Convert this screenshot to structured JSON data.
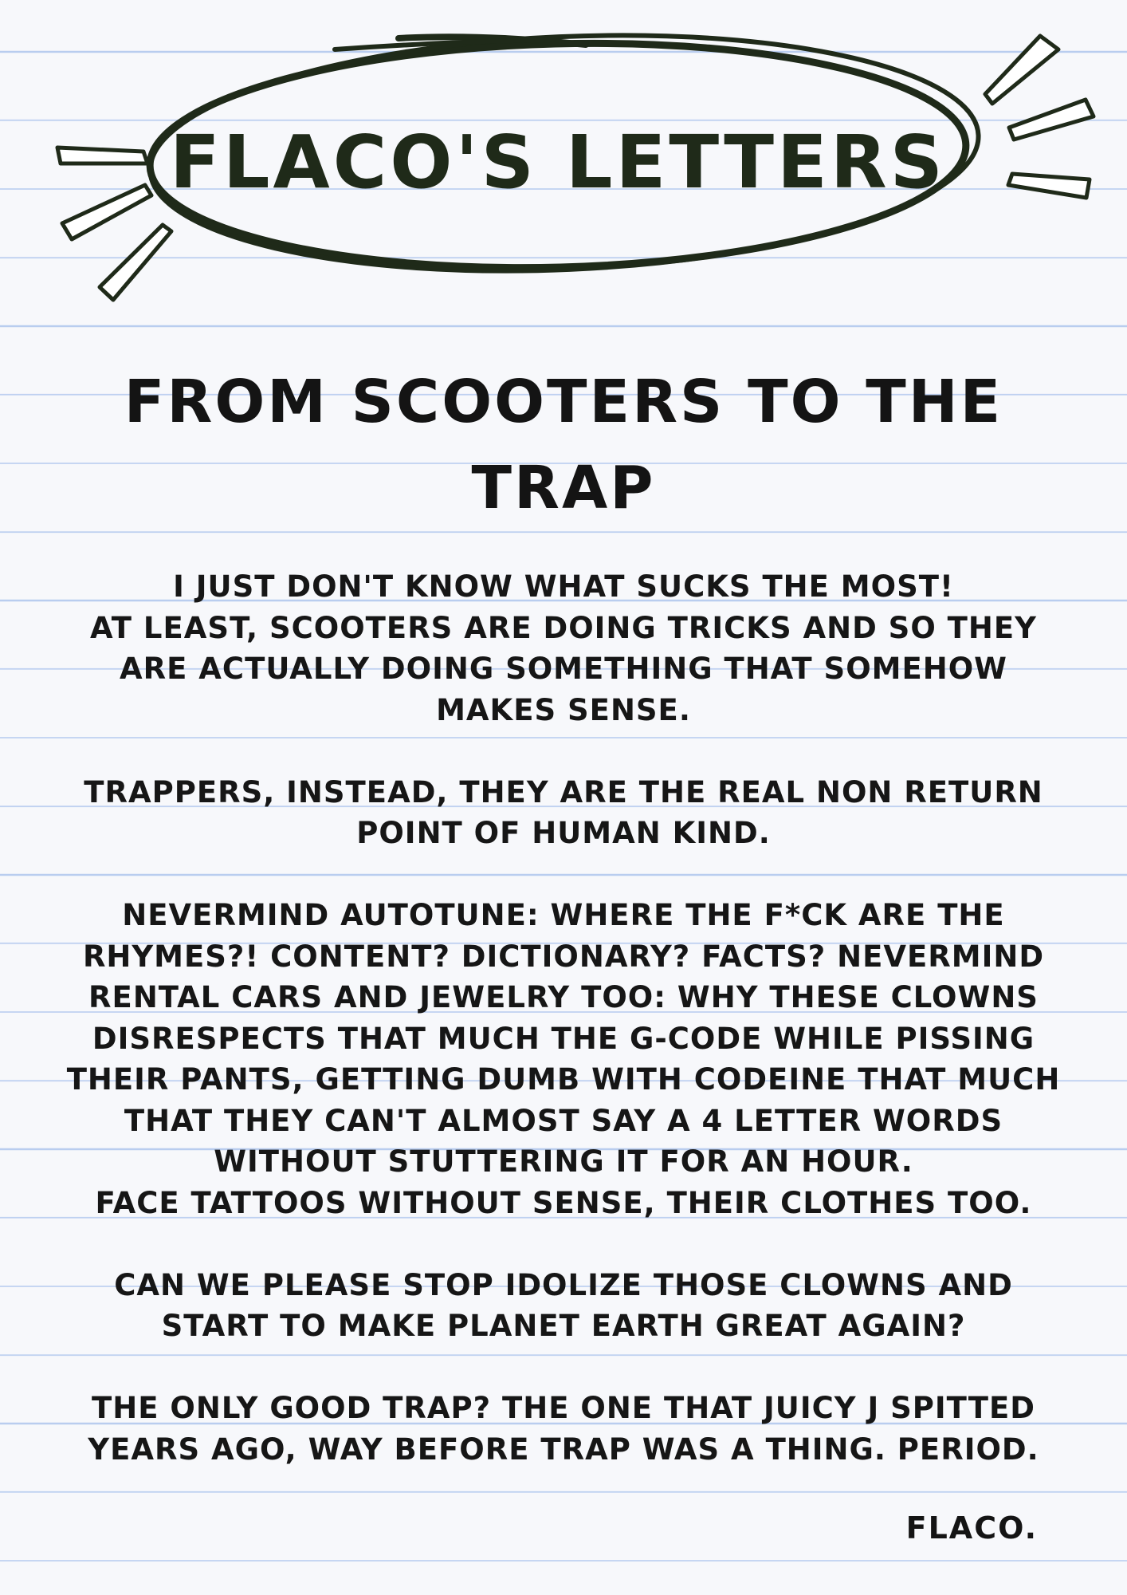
{
  "header": {
    "title": "FLACO'S LETTERS"
  },
  "article": {
    "headline": "FROM SCOOTERS TO THE TRAP",
    "paragraphs": [
      "I JUST DON'T KNOW WHAT SUCKS THE MOST!\nAT LEAST, SCOOTERS ARE DOING TRICKS AND SO THEY ARE ACTUALLY DOING SOMETHING THAT SOMEHOW MAKES SENSE.",
      "TRAPPERS, INSTEAD, THEY ARE THE REAL NON RETURN POINT OF HUMAN KIND.",
      "NEVERMIND AUTOTUNE: WHERE THE F*CK ARE THE RHYMES?! CONTENT? DICTIONARY? FACTS? NEVERMIND RENTAL CARS AND JEWELRY TOO: WHY THESE CLOWNS DISRESPECTS THAT MUCH THE G-CODE WHILE PISSING THEIR PANTS, GETTING DUMB WITH CODEINE THAT MUCH THAT THEY CAN'T ALMOST SAY A 4 LETTER WORDS WITHOUT STUTTERING IT FOR AN HOUR.\nFACE TATTOOS WITHOUT SENSE, THEIR CLOTHES TOO.",
      "CAN WE PLEASE STOP IDOLIZE THOSE CLOWNS AND START TO MAKE PLANET EARTH GREAT AGAIN?",
      "THE ONLY GOOD TRAP? THE ONE THAT JUICY J SPITTED YEARS AGO, WAY BEFORE TRAP WAS A THING. PERIOD."
    ],
    "signature": "FLACO."
  },
  "colors": {
    "paper": "#f7f8fb",
    "rule_line": "#b9cdef",
    "ink": "#1f2a19"
  }
}
